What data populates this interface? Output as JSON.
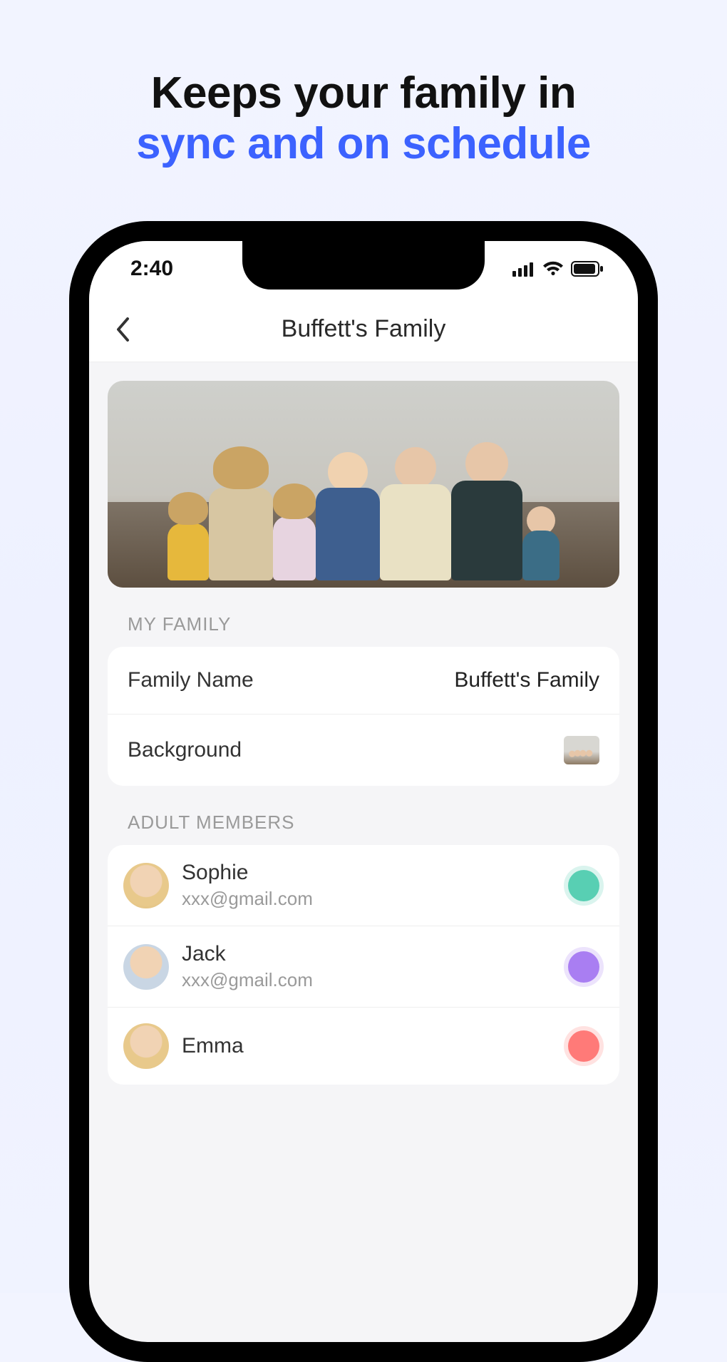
{
  "hero": {
    "line1": "Keeps your family in",
    "line2": "sync and on schedule"
  },
  "statusbar": {
    "time": "2:40"
  },
  "nav": {
    "title": "Buffett's Family"
  },
  "sections": {
    "my_family_header": "MY FAMILY",
    "adult_members_header": "ADULT MEMBERS"
  },
  "family": {
    "name_label": "Family Name",
    "name_value": "Buffett's Family",
    "background_label": "Background"
  },
  "members": [
    {
      "name": "Sophie",
      "email": "xxx@gmail.com",
      "color": "teal",
      "avatar": "a-sophie"
    },
    {
      "name": "Jack",
      "email": "xxx@gmail.com",
      "color": "purple",
      "avatar": "a-jack"
    },
    {
      "name": "Emma",
      "email": "",
      "color": "coral",
      "avatar": "a-emma"
    }
  ]
}
